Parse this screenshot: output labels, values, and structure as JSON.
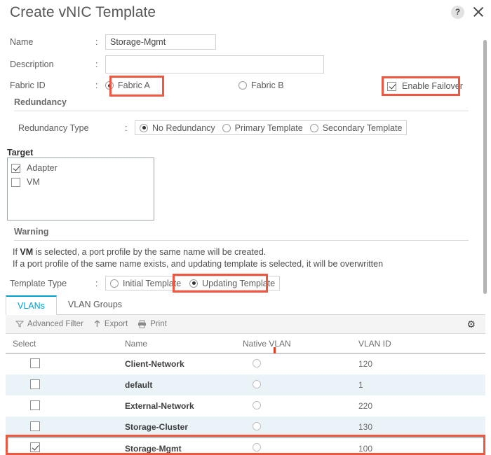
{
  "dialog": {
    "title": "Create vNIC Template",
    "help_icon": "help-icon",
    "help_glyph": "?",
    "close_icon": "close-icon"
  },
  "form": {
    "name": {
      "label": "Name",
      "separator": ":",
      "value": "Storage-Mgmt"
    },
    "description": {
      "label": "Description",
      "separator": ":",
      "value": "",
      "placeholder": ""
    },
    "fabric_id": {
      "label": "Fabric ID",
      "separator": ":",
      "options": [
        {
          "label": "Fabric A",
          "selected": true
        },
        {
          "label": "Fabric B",
          "selected": false
        }
      ]
    },
    "enable_failover": {
      "label": "Enable Failover",
      "checked": true
    }
  },
  "redundancy": {
    "heading": "Redundancy",
    "type": {
      "label": "Redundancy Type",
      "separator": ":",
      "options": [
        {
          "label": "No Redundancy",
          "selected": true
        },
        {
          "label": "Primary Template",
          "selected": false
        },
        {
          "label": "Secondary Template",
          "selected": false
        }
      ]
    }
  },
  "target": {
    "heading": "Target",
    "items": [
      {
        "label": "Adapter",
        "checked": true
      },
      {
        "label": "VM",
        "checked": false
      }
    ]
  },
  "warning": {
    "heading": "Warning",
    "line1_pre": "If ",
    "line1_bold": "VM",
    "line1_post": " is selected, a port profile by the same name will be created.",
    "line2": "If a port profile of the same name exists, and updating template is selected, it will be overwritten"
  },
  "template_type": {
    "label": "Template Type",
    "separator": ":",
    "options": [
      {
        "label": "Initial Template",
        "selected": false
      },
      {
        "label": "Updating Template",
        "selected": true
      }
    ]
  },
  "tabs": [
    {
      "label": "VLANs",
      "active": true
    },
    {
      "label": "VLAN Groups",
      "active": false
    }
  ],
  "toolbar": {
    "advanced_filter": {
      "label": "Advanced Filter",
      "icon": "filter-icon"
    },
    "export": {
      "label": "Export",
      "icon": "export-arrow-icon"
    },
    "print": {
      "label": "Print",
      "icon": "printer-icon"
    },
    "settings": {
      "icon": "gear-icon"
    }
  },
  "table": {
    "columns": [
      "Select",
      "Name",
      "Native VLAN",
      "VLAN ID"
    ],
    "rows": [
      {
        "selected": false,
        "name": "Client-Network",
        "native": false,
        "vlan_id": "120"
      },
      {
        "selected": false,
        "name": "default",
        "native": false,
        "vlan_id": "1"
      },
      {
        "selected": false,
        "name": "External-Network",
        "native": false,
        "vlan_id": "220"
      },
      {
        "selected": false,
        "name": "Storage-Cluster",
        "native": false,
        "vlan_id": "130"
      },
      {
        "selected": true,
        "name": "Storage-Mgmt",
        "native": false,
        "vlan_id": "100"
      }
    ]
  },
  "annotations": {
    "highlight_color": "#ef5840",
    "accent_color": "#00a0d1",
    "boxes": [
      "fabric-a-option",
      "enable-failover-checkbox",
      "updating-template-option",
      "storage-mgmt-row"
    ]
  }
}
